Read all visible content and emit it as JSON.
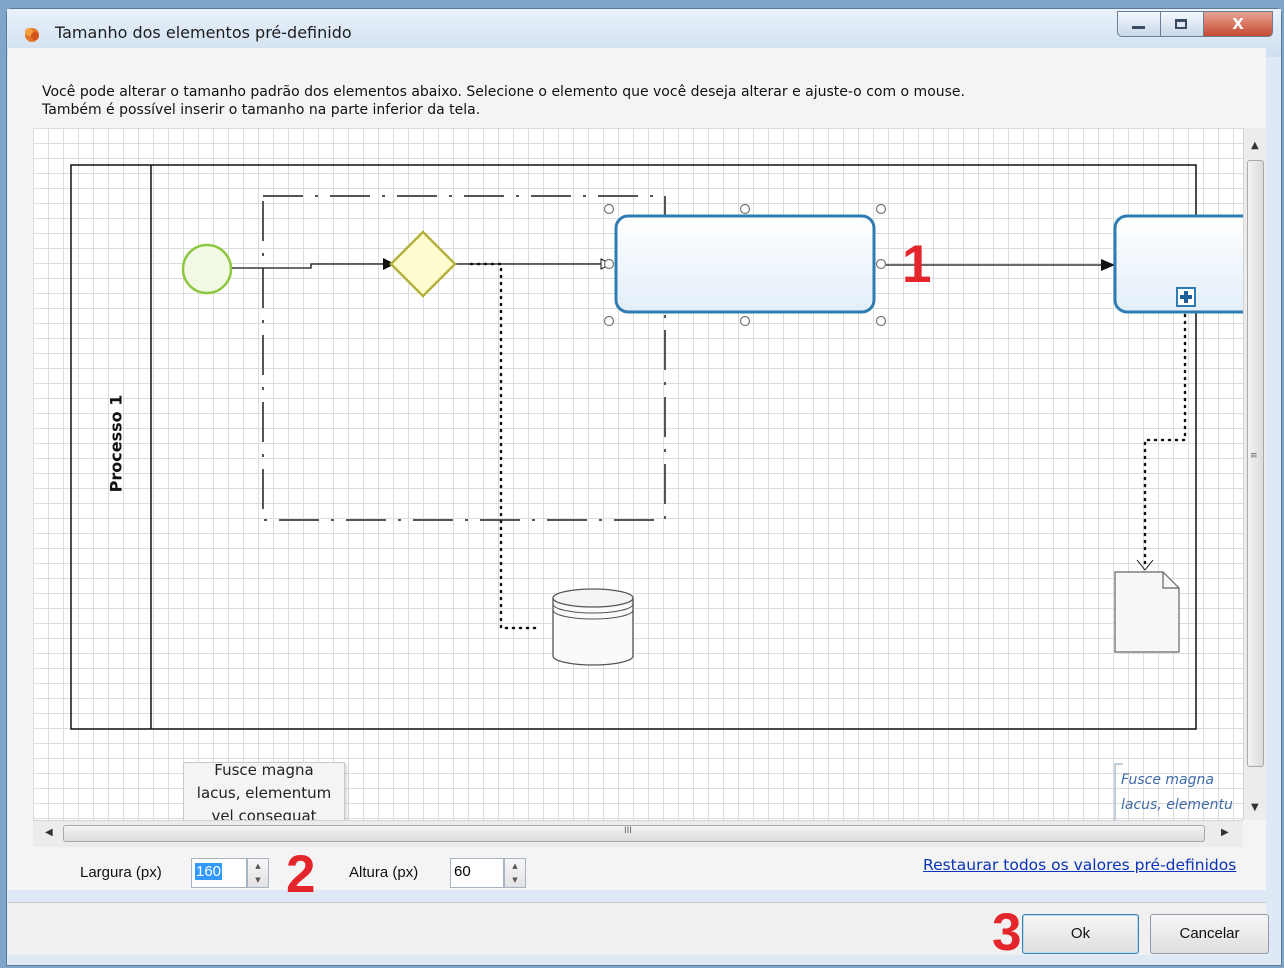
{
  "window": {
    "title": "Tamanho dos elementos pré-definido",
    "close_glyph": "X"
  },
  "description": {
    "line1": "Você pode alterar o tamanho padrão dos elementos abaixo. Selecione o elemento que você deseja alterar e ajuste-o com o mouse.",
    "line2": "Também é possível inserir o tamanho na parte inferior da tela."
  },
  "canvas": {
    "pool_label": "Processo 1",
    "callout_number": "1",
    "text_annotation_1": [
      "Fusce magna",
      "lacus, elementum",
      "vel consequat"
    ],
    "text_annotation_2": [
      "Fusce magna",
      "lacus, elementu"
    ]
  },
  "size": {
    "width_label": "Largura (px)",
    "width_value": "160",
    "height_label": "Altura (px)",
    "height_value": "60",
    "callout_number": "2"
  },
  "restore_link": "Restaurar todos os valores pré-definidos",
  "footer": {
    "callout_number": "3",
    "ok_label": "Ok",
    "cancel_label": "Cancelar"
  },
  "scroll": {
    "hthumb_glyph": "III",
    "vthumb_glyph": "≡"
  },
  "colors": {
    "task_border": "#2d7cb3",
    "start_event": "#8dc63f",
    "gateway_fill": "#fff9c4",
    "gateway_border": "#b5b138",
    "callout": "#e4262c",
    "link": "#0c33b8"
  },
  "icons": {
    "app": "app-logo-icon",
    "subprocess_marker": "plus-icon",
    "data_store": "database-icon",
    "data_object": "document-icon"
  }
}
